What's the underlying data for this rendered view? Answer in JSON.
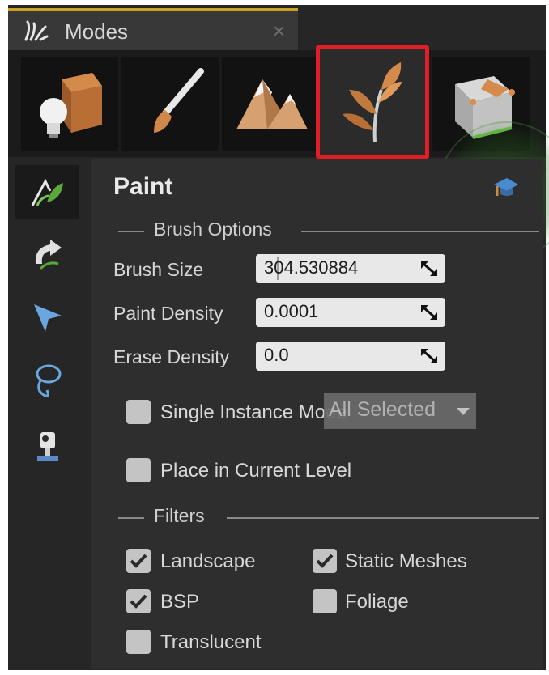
{
  "tab": {
    "title": "Modes",
    "close_glyph": "×"
  },
  "modes": [
    {
      "name": "place-mode",
      "icon": "cube-lightbulb-icon"
    },
    {
      "name": "paint-mode",
      "icon": "paintbrush-icon"
    },
    {
      "name": "landscape-mode",
      "icon": "mountains-icon"
    },
    {
      "name": "foliage-mode",
      "icon": "plant-leaf-icon",
      "selected": true
    },
    {
      "name": "geometry-mode",
      "icon": "geometry-cube-icon"
    }
  ],
  "sidebar": [
    {
      "name": "paint-tool",
      "icon": "foliage-paint-icon",
      "active": true
    },
    {
      "name": "reapply-tool",
      "icon": "reapply-icon"
    },
    {
      "name": "select-tool",
      "icon": "select-arrow-icon"
    },
    {
      "name": "lasso-tool",
      "icon": "lasso-icon"
    },
    {
      "name": "fill-tool",
      "icon": "paint-bucket-icon"
    }
  ],
  "panel": {
    "title": "Paint",
    "brush_options_label": "Brush Options",
    "brush_size_label": "Brush Size",
    "brush_size_value": "304.530884",
    "paint_density_label": "Paint Density",
    "paint_density_value": "0.0001",
    "erase_density_label": "Erase Density",
    "erase_density_value": "0.0",
    "single_instance_label": "Single Instance Mode",
    "single_instance_checked": false,
    "single_instance_dropdown": "All Selected",
    "place_in_level_label": "Place in Current Level",
    "place_in_level_checked": false,
    "filters_label": "Filters",
    "filters": {
      "landscape": {
        "label": "Landscape",
        "checked": true
      },
      "static_meshes": {
        "label": "Static Meshes",
        "checked": true
      },
      "bsp": {
        "label": "BSP",
        "checked": true
      },
      "foliage": {
        "label": "Foliage",
        "checked": false
      },
      "translucent": {
        "label": "Translucent",
        "checked": false
      }
    }
  },
  "colors": {
    "selection_highlight": "#e01e25",
    "tab_accent": "#c9a227",
    "panel_bg": "#2e2e2e",
    "glow": "#3c8c28"
  }
}
